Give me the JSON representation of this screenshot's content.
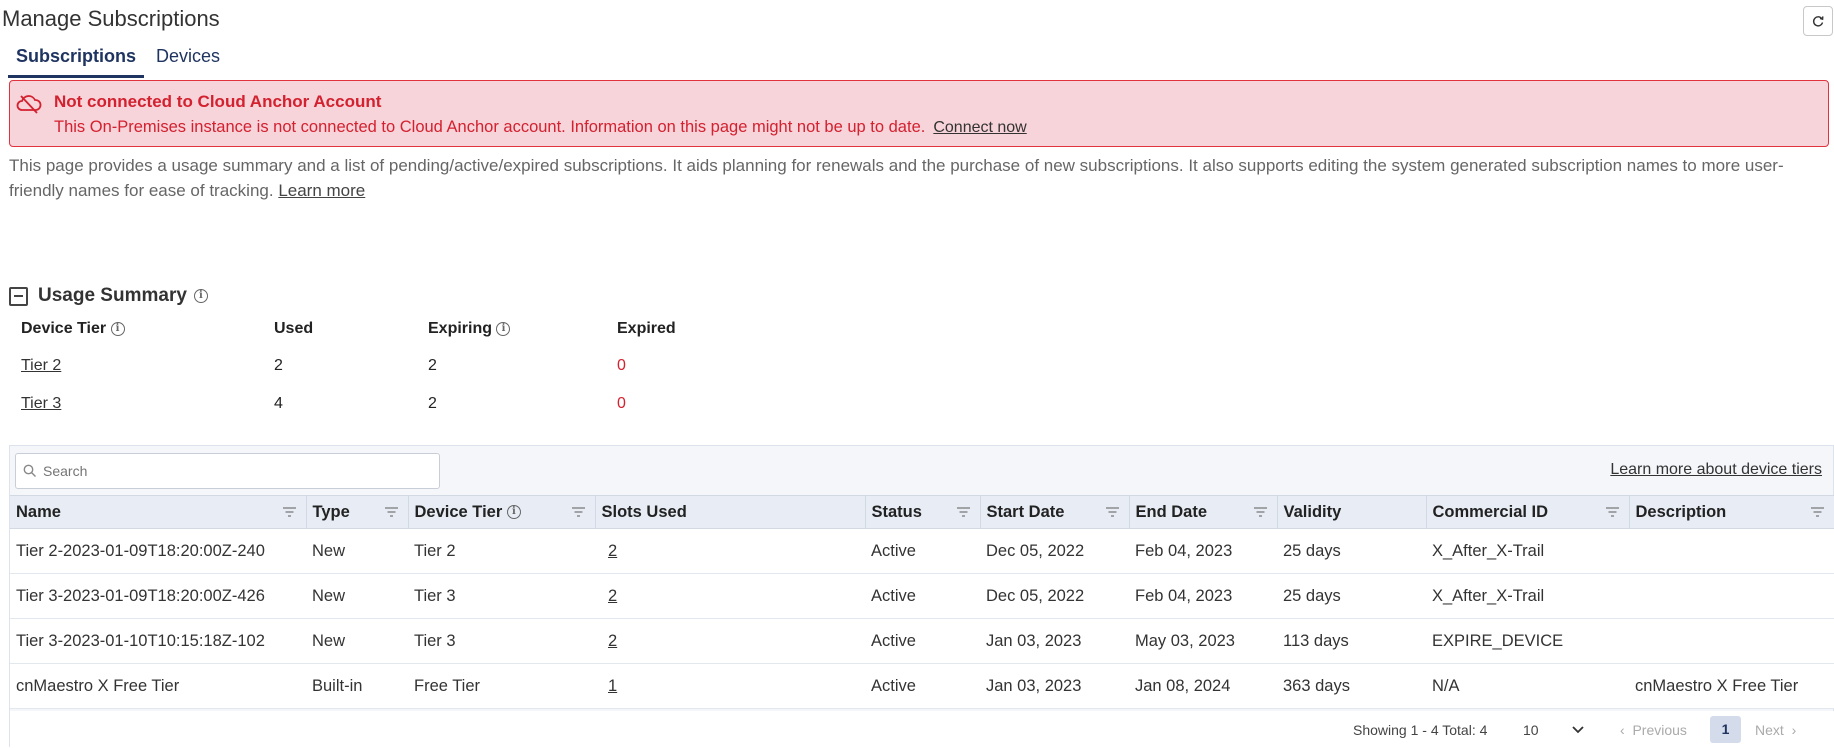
{
  "page": {
    "title": "Manage Subscriptions",
    "refresh_icon": "refresh-icon"
  },
  "tabs": [
    {
      "label": "Subscriptions",
      "active": true
    },
    {
      "label": "Devices",
      "active": false
    }
  ],
  "alert": {
    "icon": "cloud-off-icon",
    "title": "Not connected to Cloud Anchor Account",
    "message": "This On-Premises instance is not connected to Cloud Anchor account. Information on this page might not be up to date.",
    "link": "Connect now",
    "color": "#d3212f",
    "background": "#f7d3da"
  },
  "intro": {
    "text": "This page provides a usage summary and a list of pending/active/expired subscriptions. It aids planning for renewals and the purchase of new subscriptions. It also supports editing the system generated subscription names to more user-friendly names for ease of tracking.",
    "link": "Learn more"
  },
  "usage_summary": {
    "title": "Usage Summary",
    "headers": {
      "tier": "Device Tier",
      "used": "Used",
      "expiring": "Expiring",
      "expired": "Expired"
    },
    "rows": [
      {
        "tier": "Tier 2",
        "used": "2",
        "expiring": "2",
        "expired": "0"
      },
      {
        "tier": "Tier 3",
        "used": "4",
        "expiring": "2",
        "expired": "0"
      }
    ]
  },
  "grid": {
    "search_placeholder": "Search",
    "learn_tiers": "Learn more about device tiers",
    "columns": {
      "name": "Name",
      "type": "Type",
      "tier": "Device Tier",
      "slots": "Slots Used",
      "status": "Status",
      "start": "Start Date",
      "end": "End Date",
      "validity": "Validity",
      "commercial": "Commercial ID",
      "description": "Description"
    },
    "rows": [
      {
        "name": "Tier 2-2023-01-09T18:20:00Z-240",
        "type": "New",
        "tier": "Tier 2",
        "slots": "2",
        "status": "Active",
        "start": "Dec 05, 2022",
        "end": "Feb 04, 2023",
        "validity": "25 days",
        "validity_warn": true,
        "commercial": "X_After_X-Trail",
        "description": ""
      },
      {
        "name": "Tier 3-2023-01-09T18:20:00Z-426",
        "type": "New",
        "tier": "Tier 3",
        "slots": "2",
        "status": "Active",
        "start": "Dec 05, 2022",
        "end": "Feb 04, 2023",
        "validity": "25 days",
        "validity_warn": true,
        "commercial": "X_After_X-Trail",
        "description": ""
      },
      {
        "name": "Tier 3-2023-01-10T10:15:18Z-102",
        "type": "New",
        "tier": "Tier 3",
        "slots": "2",
        "status": "Active",
        "start": "Jan 03, 2023",
        "end": "May 03, 2023",
        "validity": "113 days",
        "validity_warn": false,
        "commercial": "EXPIRE_DEVICE",
        "description": ""
      },
      {
        "name": "cnMaestro X Free Tier",
        "type": "Built-in",
        "tier": "Free Tier",
        "slots": "1",
        "status": "Active",
        "start": "Jan 03, 2023",
        "end": "Jan 08, 2024",
        "validity": "363 days",
        "validity_warn": false,
        "commercial": "N/A",
        "description": "cnMaestro X Free Tier"
      }
    ],
    "footer": {
      "showing": "Showing 1 - 4 Total: 4",
      "page_size": "10",
      "previous": "Previous",
      "page": "1",
      "next": "Next"
    },
    "colors": {
      "active": "#3a8a4c",
      "warn": "#e8661d"
    }
  }
}
